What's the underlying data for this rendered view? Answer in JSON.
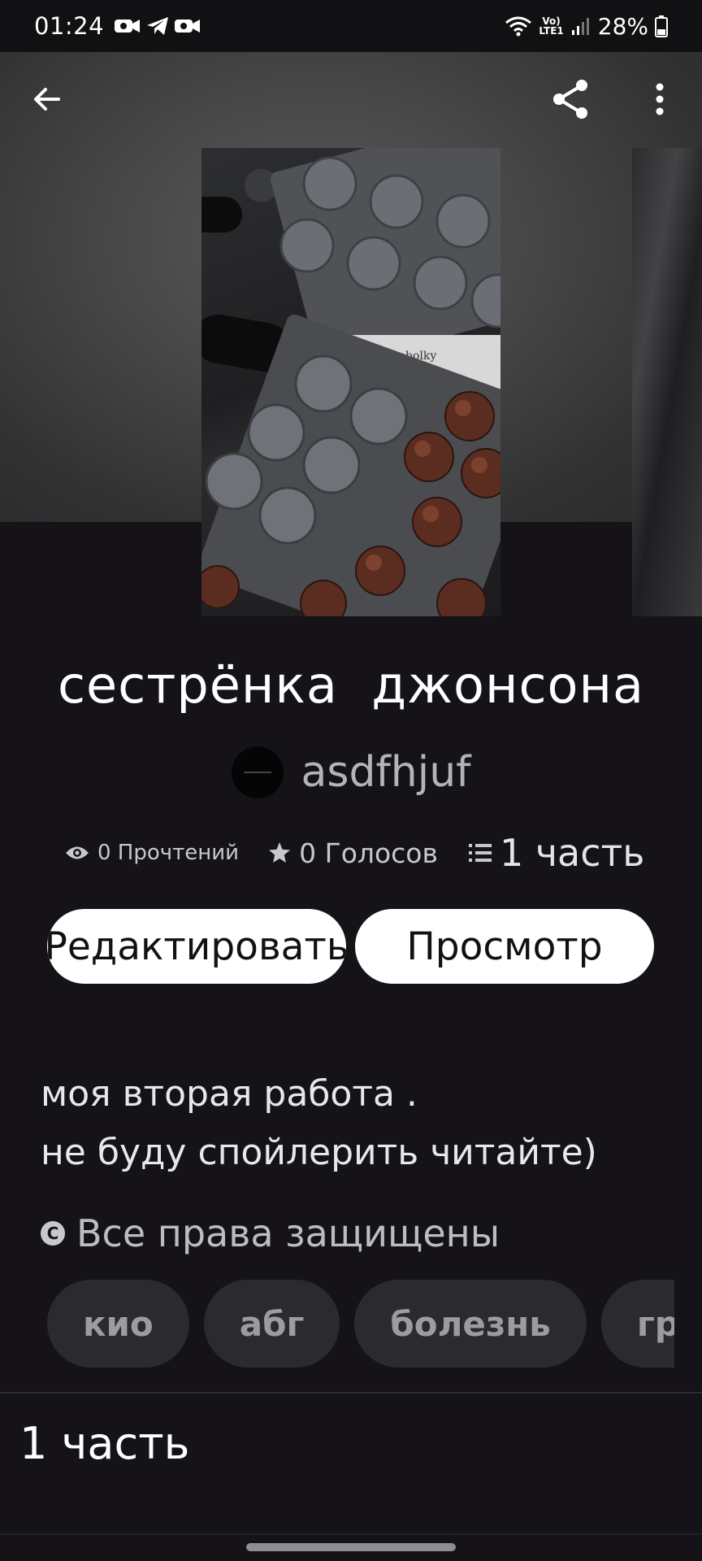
{
  "status_bar": {
    "time": "01:24",
    "battery": "28%",
    "network_top": "Vo)",
    "network_bottom": "LTE1"
  },
  "story": {
    "title": "сестрёнка  джонсона",
    "author": "asdfhjuf",
    "reads": "0 Прочтений",
    "votes": "0 Голосов",
    "parts": "1 часть"
  },
  "buttons": {
    "edit": "Редактировать",
    "preview": "Просмотр"
  },
  "description": {
    "line1": "моя вторая работа .",
    "line2": "не буду спойлерить читайте)"
  },
  "rights": {
    "label": "Все права защищены",
    "icon_text": "C"
  },
  "tags": [
    "кио",
    "абг",
    "болезнь",
    "гриф"
  ],
  "parts_section": {
    "heading": "1 часть"
  },
  "icons": {
    "back": "arrow-left-icon",
    "share": "share-icon",
    "more": "more-vert-icon",
    "reads": "eye-icon",
    "votes": "star-icon",
    "parts": "list-icon",
    "rights": "copyright-icon"
  },
  "colors": {
    "background": "#151317",
    "button_bg": "#ffffff",
    "tag_bg": "#2b2a2e"
  }
}
